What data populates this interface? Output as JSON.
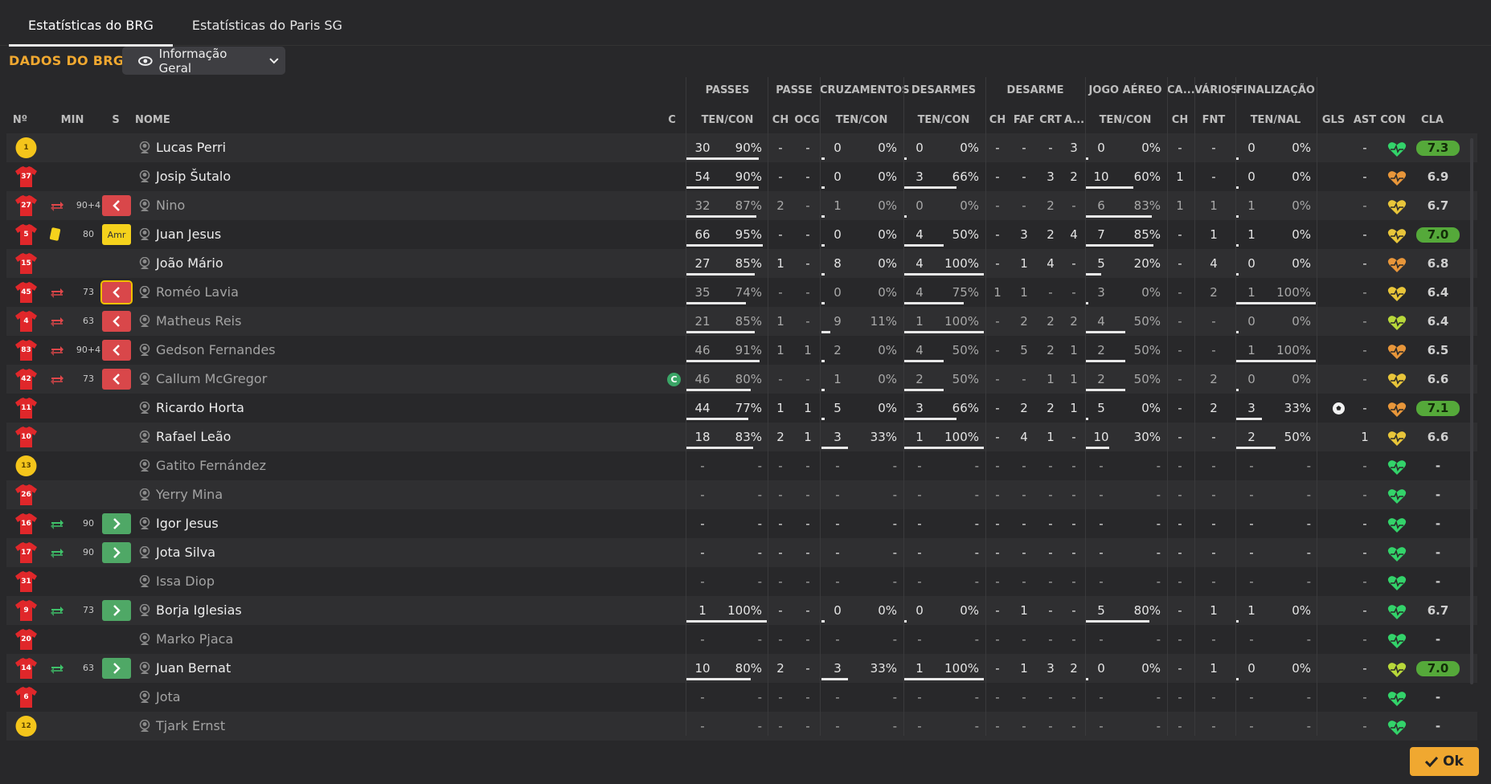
{
  "tabs": [
    "Estatísticas do BRG",
    "Estatísticas do Paris SG"
  ],
  "title": "DADOS DO BRG",
  "dropdown": {
    "label": "Informação Geral",
    "icon": "eye-icon"
  },
  "groups": {
    "passes": "PASSES",
    "passe": "PASSE",
    "cruzamentos": "CRUZAMENTOS",
    "desarmes": "DESARMES",
    "desarme": "DESARME",
    "jogo_aereo": "JOGO AÉREO",
    "ca": "CA...",
    "varios": "VÁRIOS",
    "finalizacao": "FINALIZAÇÃO"
  },
  "cols": {
    "no": "Nº",
    "min": "MIN",
    "s": "S",
    "nome": "NOME",
    "c": "C",
    "passes": "TEN/CON",
    "passe_ch": "CH",
    "passe_ocg": "OCG",
    "cruz": "TEN/CON",
    "desarmes": "TEN/CON",
    "d_ch": "CH",
    "d_faf": "FAF",
    "d_crt": "CRT",
    "d_a": "A...",
    "aereo": "TEN/CON",
    "ca_ch": "CH",
    "fnt": "FNT",
    "fin": "TEN/NAL",
    "gls": "GLS",
    "ast": "AST",
    "con": "CON",
    "cla": "CLA"
  },
  "ok": "Ok",
  "colors": {
    "accent": "#f0a830",
    "good": "#55a93a",
    "sub_in": "#4fa866",
    "sub_out": "#d9474a",
    "card": "#f5d21c",
    "shirt_red": "#e0272a",
    "shirt_yellow": "#f4c51b"
  },
  "rows": [
    {
      "num": "1",
      "shirt": "yellow",
      "sub": "",
      "min": "",
      "s": "",
      "name": "Lucas Perri",
      "dim": false,
      "cap": "",
      "pass": [
        "30",
        "90%"
      ],
      "passfill": 0.9,
      "ch": "-",
      "ocg": "-",
      "cruz": [
        "0",
        "0%"
      ],
      "cruzfill": 0,
      "des": [
        "0",
        "0%"
      ],
      "desfill": 0,
      "dch": "-",
      "faf": "-",
      "crt": "-",
      "da": "3",
      "aer": [
        "0",
        "0%"
      ],
      "aerfill": 0,
      "cach": "-",
      "fnt": "-",
      "fin": [
        "0",
        "0%"
      ],
      "finfill": 0,
      "gls": "",
      "ast": "-",
      "con": "green",
      "cla": "7.3",
      "claGood": true
    },
    {
      "num": "37",
      "shirt": "red",
      "sub": "",
      "min": "",
      "s": "",
      "name": "Josip Šutalo",
      "dim": false,
      "cap": "",
      "pass": [
        "54",
        "90%"
      ],
      "passfill": 0.9,
      "ch": "-",
      "ocg": "-",
      "cruz": [
        "0",
        "0%"
      ],
      "cruzfill": 0,
      "des": [
        "3",
        "66%"
      ],
      "desfill": 0.66,
      "dch": "-",
      "faf": "-",
      "crt": "3",
      "da": "2",
      "aer": [
        "10",
        "60%"
      ],
      "aerfill": 0.6,
      "cach": "1",
      "fnt": "-",
      "fin": [
        "0",
        "0%"
      ],
      "finfill": 0,
      "gls": "",
      "ast": "-",
      "con": "orange",
      "cla": "6.9",
      "claGood": false
    },
    {
      "num": "27",
      "shirt": "red",
      "sub": "out",
      "min": "90+4",
      "s": "out",
      "name": "Nino",
      "dim": true,
      "cap": "",
      "pass": [
        "32",
        "87%"
      ],
      "passfill": 0.87,
      "ch": "2",
      "ocg": "-",
      "cruz": [
        "1",
        "0%"
      ],
      "cruzfill": 0,
      "des": [
        "0",
        "0%"
      ],
      "desfill": 0,
      "dch": "-",
      "faf": "-",
      "crt": "2",
      "da": "-",
      "aer": [
        "6",
        "83%"
      ],
      "aerfill": 0.83,
      "cach": "1",
      "fnt": "1",
      "fin": [
        "1",
        "0%"
      ],
      "finfill": 0,
      "gls": "",
      "ast": "-",
      "con": "yellow",
      "cla": "6.7",
      "claGood": false
    },
    {
      "num": "5",
      "shirt": "red",
      "sub": "card",
      "min": "80",
      "s": "amr",
      "name": "Juan Jesus",
      "dim": false,
      "cap": "",
      "pass": [
        "66",
        "95%"
      ],
      "passfill": 0.95,
      "ch": "-",
      "ocg": "-",
      "cruz": [
        "0",
        "0%"
      ],
      "cruzfill": 0,
      "des": [
        "4",
        "50%"
      ],
      "desfill": 0.5,
      "dch": "-",
      "faf": "3",
      "crt": "2",
      "da": "4",
      "aer": [
        "7",
        "85%"
      ],
      "aerfill": 0.85,
      "cach": "-",
      "fnt": "1",
      "fin": [
        "1",
        "0%"
      ],
      "finfill": 0,
      "gls": "",
      "ast": "-",
      "con": "yellow",
      "cla": "7.0",
      "claGood": true
    },
    {
      "num": "15",
      "shirt": "red",
      "sub": "",
      "min": "",
      "s": "",
      "name": "João Mário",
      "dim": false,
      "cap": "",
      "pass": [
        "27",
        "85%"
      ],
      "passfill": 0.85,
      "ch": "1",
      "ocg": "-",
      "cruz": [
        "8",
        "0%"
      ],
      "cruzfill": 0,
      "des": [
        "4",
        "100%"
      ],
      "desfill": 1,
      "dch": "-",
      "faf": "1",
      "crt": "4",
      "da": "-",
      "aer": [
        "5",
        "20%"
      ],
      "aerfill": 0.2,
      "cach": "-",
      "fnt": "4",
      "fin": [
        "0",
        "0%"
      ],
      "finfill": 0,
      "gls": "",
      "ast": "-",
      "con": "orange",
      "cla": "6.8",
      "claGood": false
    },
    {
      "num": "45",
      "shirt": "red",
      "sub": "out",
      "min": "73",
      "s": "outb",
      "name": "Roméo Lavia",
      "dim": true,
      "cap": "",
      "pass": [
        "35",
        "74%"
      ],
      "passfill": 0.74,
      "ch": "-",
      "ocg": "-",
      "cruz": [
        "0",
        "0%"
      ],
      "cruzfill": 0,
      "des": [
        "4",
        "75%"
      ],
      "desfill": 0.75,
      "dch": "1",
      "faf": "1",
      "crt": "-",
      "da": "-",
      "aer": [
        "3",
        "0%"
      ],
      "aerfill": 0,
      "cach": "-",
      "fnt": "2",
      "fin": [
        "1",
        "100%"
      ],
      "finfill": 1,
      "gls": "",
      "ast": "-",
      "con": "yellow",
      "cla": "6.4",
      "claGood": false
    },
    {
      "num": "4",
      "shirt": "red",
      "sub": "out",
      "min": "63",
      "s": "out",
      "name": "Matheus Reis",
      "dim": true,
      "cap": "",
      "pass": [
        "21",
        "85%"
      ],
      "passfill": 0.85,
      "ch": "1",
      "ocg": "-",
      "cruz": [
        "9",
        "11%"
      ],
      "cruzfill": 0.11,
      "des": [
        "1",
        "100%"
      ],
      "desfill": 1,
      "dch": "-",
      "faf": "2",
      "crt": "2",
      "da": "2",
      "aer": [
        "4",
        "50%"
      ],
      "aerfill": 0.5,
      "cach": "-",
      "fnt": "-",
      "fin": [
        "0",
        "0%"
      ],
      "finfill": 0,
      "gls": "",
      "ast": "-",
      "con": "lime",
      "cla": "6.4",
      "claGood": false
    },
    {
      "num": "83",
      "shirt": "red",
      "sub": "out",
      "min": "90+4",
      "s": "out",
      "name": "Gedson Fernandes",
      "dim": true,
      "cap": "",
      "pass": [
        "46",
        "91%"
      ],
      "passfill": 0.91,
      "ch": "1",
      "ocg": "1",
      "cruz": [
        "2",
        "0%"
      ],
      "cruzfill": 0,
      "des": [
        "4",
        "50%"
      ],
      "desfill": 0.5,
      "dch": "-",
      "faf": "5",
      "crt": "2",
      "da": "1",
      "aer": [
        "2",
        "50%"
      ],
      "aerfill": 0.5,
      "cach": "-",
      "fnt": "-",
      "fin": [
        "1",
        "100%"
      ],
      "finfill": 1,
      "gls": "",
      "ast": "-",
      "con": "orange",
      "cla": "6.5",
      "claGood": false
    },
    {
      "num": "42",
      "shirt": "red",
      "sub": "out",
      "min": "73",
      "s": "out",
      "name": "Callum McGregor",
      "dim": true,
      "cap": "C",
      "pass": [
        "46",
        "80%"
      ],
      "passfill": 0.8,
      "ch": "-",
      "ocg": "-",
      "cruz": [
        "1",
        "0%"
      ],
      "cruzfill": 0,
      "des": [
        "2",
        "50%"
      ],
      "desfill": 0.5,
      "dch": "-",
      "faf": "-",
      "crt": "1",
      "da": "1",
      "aer": [
        "2",
        "50%"
      ],
      "aerfill": 0.5,
      "cach": "-",
      "fnt": "2",
      "fin": [
        "0",
        "0%"
      ],
      "finfill": 0,
      "gls": "",
      "ast": "-",
      "con": "yellow",
      "cla": "6.6",
      "claGood": false
    },
    {
      "num": "11",
      "shirt": "red",
      "sub": "",
      "min": "",
      "s": "",
      "name": "Ricardo Horta",
      "dim": false,
      "cap": "",
      "pass": [
        "44",
        "77%"
      ],
      "passfill": 0.77,
      "ch": "1",
      "ocg": "1",
      "cruz": [
        "5",
        "0%"
      ],
      "cruzfill": 0,
      "des": [
        "3",
        "66%"
      ],
      "desfill": 0.66,
      "dch": "-",
      "faf": "2",
      "crt": "2",
      "da": "1",
      "aer": [
        "5",
        "0%"
      ],
      "aerfill": 0,
      "cach": "-",
      "fnt": "2",
      "fin": [
        "3",
        "33%"
      ],
      "finfill": 0.33,
      "gls": "ball",
      "ast": "-",
      "con": "orange",
      "cla": "7.1",
      "claGood": true
    },
    {
      "num": "10",
      "shirt": "red",
      "sub": "",
      "min": "",
      "s": "",
      "name": "Rafael Leão",
      "dim": false,
      "cap": "",
      "pass": [
        "18",
        "83%"
      ],
      "passfill": 0.83,
      "ch": "2",
      "ocg": "1",
      "cruz": [
        "3",
        "33%"
      ],
      "cruzfill": 0.33,
      "des": [
        "1",
        "100%"
      ],
      "desfill": 1,
      "dch": "-",
      "faf": "4",
      "crt": "1",
      "da": "-",
      "aer": [
        "10",
        "30%"
      ],
      "aerfill": 0.3,
      "cach": "-",
      "fnt": "-",
      "fin": [
        "2",
        "50%"
      ],
      "finfill": 0.5,
      "gls": "",
      "ast": "1",
      "con": "yellow",
      "cla": "6.6",
      "claGood": false
    },
    {
      "num": "13",
      "shirt": "yellow",
      "sub": "",
      "min": "",
      "s": "",
      "name": "Gatito Fernández",
      "dim": true,
      "cap": "",
      "pass": [
        "-",
        "-"
      ],
      "passfill": 0,
      "ch": "-",
      "ocg": "-",
      "cruz": [
        "-",
        "-"
      ],
      "cruzfill": 0,
      "des": [
        "-",
        "-"
      ],
      "desfill": 0,
      "dch": "-",
      "faf": "-",
      "crt": "-",
      "da": "-",
      "aer": [
        "-",
        "-"
      ],
      "aerfill": 0,
      "cach": "-",
      "fnt": "-",
      "fin": [
        "-",
        "-"
      ],
      "finfill": 0,
      "gls": "",
      "ast": "-",
      "con": "green",
      "cla": "-",
      "claGood": false
    },
    {
      "num": "26",
      "shirt": "red",
      "sub": "",
      "min": "",
      "s": "",
      "name": "Yerry Mina",
      "dim": true,
      "cap": "",
      "pass": [
        "-",
        "-"
      ],
      "passfill": 0,
      "ch": "-",
      "ocg": "-",
      "cruz": [
        "-",
        "-"
      ],
      "cruzfill": 0,
      "des": [
        "-",
        "-"
      ],
      "desfill": 0,
      "dch": "-",
      "faf": "-",
      "crt": "-",
      "da": "-",
      "aer": [
        "-",
        "-"
      ],
      "aerfill": 0,
      "cach": "-",
      "fnt": "-",
      "fin": [
        "-",
        "-"
      ],
      "finfill": 0,
      "gls": "",
      "ast": "-",
      "con": "green",
      "cla": "-",
      "claGood": false
    },
    {
      "num": "16",
      "shirt": "red",
      "sub": "in",
      "min": "90",
      "s": "in",
      "name": "Igor Jesus",
      "dim": false,
      "cap": "",
      "pass": [
        "-",
        "-"
      ],
      "passfill": 0,
      "ch": "-",
      "ocg": "-",
      "cruz": [
        "-",
        "-"
      ],
      "cruzfill": 0,
      "des": [
        "-",
        "-"
      ],
      "desfill": 0,
      "dch": "-",
      "faf": "-",
      "crt": "-",
      "da": "-",
      "aer": [
        "-",
        "-"
      ],
      "aerfill": 0,
      "cach": "-",
      "fnt": "-",
      "fin": [
        "-",
        "-"
      ],
      "finfill": 0,
      "gls": "",
      "ast": "-",
      "con": "green",
      "cla": "-",
      "claGood": false
    },
    {
      "num": "17",
      "shirt": "red",
      "sub": "in",
      "min": "90",
      "s": "in",
      "name": "Jota Silva",
      "dim": false,
      "cap": "",
      "pass": [
        "-",
        "-"
      ],
      "passfill": 0,
      "ch": "-",
      "ocg": "-",
      "cruz": [
        "-",
        "-"
      ],
      "cruzfill": 0,
      "des": [
        "-",
        "-"
      ],
      "desfill": 0,
      "dch": "-",
      "faf": "-",
      "crt": "-",
      "da": "-",
      "aer": [
        "-",
        "-"
      ],
      "aerfill": 0,
      "cach": "-",
      "fnt": "-",
      "fin": [
        "-",
        "-"
      ],
      "finfill": 0,
      "gls": "",
      "ast": "-",
      "con": "green",
      "cla": "-",
      "claGood": false
    },
    {
      "num": "31",
      "shirt": "red",
      "sub": "",
      "min": "",
      "s": "",
      "name": "Issa Diop",
      "dim": true,
      "cap": "",
      "pass": [
        "-",
        "-"
      ],
      "passfill": 0,
      "ch": "-",
      "ocg": "-",
      "cruz": [
        "-",
        "-"
      ],
      "cruzfill": 0,
      "des": [
        "-",
        "-"
      ],
      "desfill": 0,
      "dch": "-",
      "faf": "-",
      "crt": "-",
      "da": "-",
      "aer": [
        "-",
        "-"
      ],
      "aerfill": 0,
      "cach": "-",
      "fnt": "-",
      "fin": [
        "-",
        "-"
      ],
      "finfill": 0,
      "gls": "",
      "ast": "-",
      "con": "green",
      "cla": "-",
      "claGood": false
    },
    {
      "num": "9",
      "shirt": "red",
      "sub": "in",
      "min": "73",
      "s": "in",
      "name": "Borja Iglesias",
      "dim": false,
      "cap": "",
      "pass": [
        "1",
        "100%"
      ],
      "passfill": 1,
      "ch": "-",
      "ocg": "-",
      "cruz": [
        "0",
        "0%"
      ],
      "cruzfill": 0,
      "des": [
        "0",
        "0%"
      ],
      "desfill": 0,
      "dch": "-",
      "faf": "1",
      "crt": "-",
      "da": "-",
      "aer": [
        "5",
        "80%"
      ],
      "aerfill": 0.8,
      "cach": "-",
      "fnt": "1",
      "fin": [
        "1",
        "0%"
      ],
      "finfill": 0,
      "gls": "",
      "ast": "-",
      "con": "green",
      "cla": "6.7",
      "claGood": false
    },
    {
      "num": "20",
      "shirt": "red",
      "sub": "",
      "min": "",
      "s": "",
      "name": "Marko Pjaca",
      "dim": true,
      "cap": "",
      "pass": [
        "-",
        "-"
      ],
      "passfill": 0,
      "ch": "-",
      "ocg": "-",
      "cruz": [
        "-",
        "-"
      ],
      "cruzfill": 0,
      "des": [
        "-",
        "-"
      ],
      "desfill": 0,
      "dch": "-",
      "faf": "-",
      "crt": "-",
      "da": "-",
      "aer": [
        "-",
        "-"
      ],
      "aerfill": 0,
      "cach": "-",
      "fnt": "-",
      "fin": [
        "-",
        "-"
      ],
      "finfill": 0,
      "gls": "",
      "ast": "-",
      "con": "green",
      "cla": "-",
      "claGood": false
    },
    {
      "num": "14",
      "shirt": "red",
      "sub": "in",
      "min": "63",
      "s": "in",
      "name": "Juan Bernat",
      "dim": false,
      "cap": "",
      "pass": [
        "10",
        "80%"
      ],
      "passfill": 0.8,
      "ch": "2",
      "ocg": "-",
      "cruz": [
        "3",
        "33%"
      ],
      "cruzfill": 0.33,
      "des": [
        "1",
        "100%"
      ],
      "desfill": 1,
      "dch": "-",
      "faf": "1",
      "crt": "3",
      "da": "2",
      "aer": [
        "0",
        "0%"
      ],
      "aerfill": 0,
      "cach": "-",
      "fnt": "1",
      "fin": [
        "0",
        "0%"
      ],
      "finfill": 0,
      "gls": "",
      "ast": "-",
      "con": "lime",
      "cla": "7.0",
      "claGood": true
    },
    {
      "num": "6",
      "shirt": "red",
      "sub": "",
      "min": "",
      "s": "",
      "name": "Jota",
      "dim": true,
      "cap": "",
      "pass": [
        "-",
        "-"
      ],
      "passfill": 0,
      "ch": "-",
      "ocg": "-",
      "cruz": [
        "-",
        "-"
      ],
      "cruzfill": 0,
      "des": [
        "-",
        "-"
      ],
      "desfill": 0,
      "dch": "-",
      "faf": "-",
      "crt": "-",
      "da": "-",
      "aer": [
        "-",
        "-"
      ],
      "aerfill": 0,
      "cach": "-",
      "fnt": "-",
      "fin": [
        "-",
        "-"
      ],
      "finfill": 0,
      "gls": "",
      "ast": "-",
      "con": "green",
      "cla": "-",
      "claGood": false
    },
    {
      "num": "12",
      "shirt": "yellow",
      "sub": "",
      "min": "",
      "s": "",
      "name": "Tjark Ernst",
      "dim": true,
      "cap": "",
      "pass": [
        "-",
        "-"
      ],
      "passfill": 0,
      "ch": "-",
      "ocg": "-",
      "cruz": [
        "-",
        "-"
      ],
      "cruzfill": 0,
      "des": [
        "-",
        "-"
      ],
      "desfill": 0,
      "dch": "-",
      "faf": "-",
      "crt": "-",
      "da": "-",
      "aer": [
        "-",
        "-"
      ],
      "aerfill": 0,
      "cach": "-",
      "fnt": "-",
      "fin": [
        "-",
        "-"
      ],
      "finfill": 0,
      "gls": "",
      "ast": "-",
      "con": "green",
      "cla": "-",
      "claGood": false
    }
  ]
}
